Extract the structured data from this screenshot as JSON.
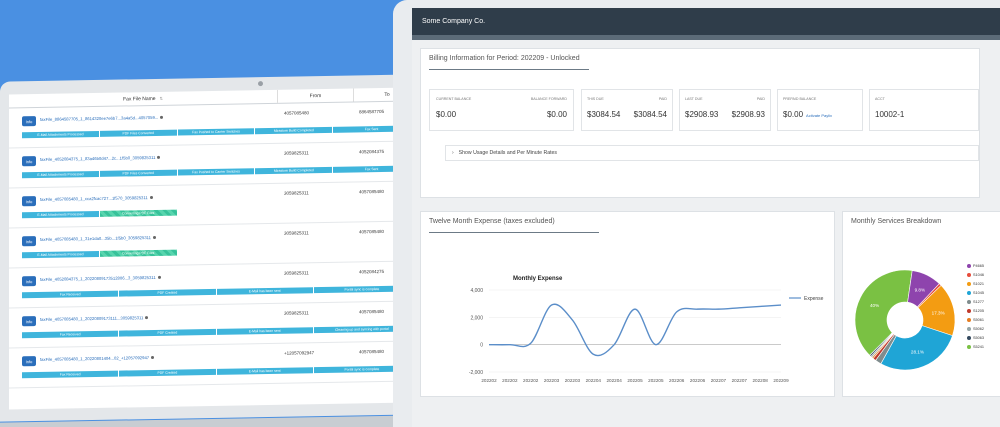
{
  "fax_list": {
    "columns": {
      "name": "Fax File Name",
      "from": "From",
      "to": "To"
    },
    "info_label": "Info",
    "rows": [
      {
        "file": "faxFile_8864587705_1_8614320ee7e6b7...3a4a5d...4057059...",
        "from": "4057085480",
        "to": "8864587705",
        "statuses": [
          "E-Mail Attachments Processed",
          "PDF Files Converted",
          "Fax Pushed to Carrier Switches",
          "Mirastore Build Completed",
          "Fax Sent"
        ]
      },
      {
        "file": "faxFile_4052084375_1_83a46b0d47...2c...1f5b0_3059825311",
        "from": "3059825311",
        "to": "4052084375",
        "statuses": [
          "E-Mail Attachments Processed",
          "PDF Files Converted",
          "Fax Pushed to Carrier Switches",
          "Mirastore Build Completed",
          "Fax Sent"
        ]
      },
      {
        "file": "faxFile_4057085480_1_cca2fcac727...1f570_3059825311",
        "from": "3059825311",
        "to": "4057085480",
        "statuses": [
          "E-Mail Attachments Processed",
          "Converting PDF Files"
        ]
      },
      {
        "file": "faxFile_4057085480_1_31e1da0...35b...1f5b0_3059825311",
        "from": "3059825311",
        "to": "4057085480",
        "statuses": [
          "E-Mail Attachments Processed",
          "Converting PDF Files"
        ]
      },
      {
        "file": "faxFile_4052084375_1_20220809173512806...3_3059825311",
        "from": "3059825311",
        "to": "4052084275",
        "statuses": [
          "Fax Received",
          "PDF Created",
          "E-Mail has been sent",
          "Portal sync is complete"
        ]
      },
      {
        "file": "faxFile_4057085480_1_20220809173111...3059825311",
        "from": "3059825311",
        "to": "4057085480",
        "statuses": [
          "Fax Received",
          "PDF Created",
          "E-Mail has been sent",
          "Cleaning up and syncing with portal"
        ]
      },
      {
        "file": "faxFile_4057085480_1_20220801404...02_+12057092947",
        "from": "+12057092947",
        "to": "4057085480",
        "statuses": [
          "Fax Received",
          "PDF Created",
          "E-Mail has been sent",
          "Portal sync is complete"
        ]
      }
    ]
  },
  "dashboard": {
    "company": "Some Company Co.",
    "billing_title": "Billing Information for Period: 202209 - Unlocked",
    "current_balance": {
      "label": "CURRENT BALANCE",
      "value": "$0.00"
    },
    "balance_forward": {
      "label": "BALANCE FORWARD",
      "value": "$0.00"
    },
    "this_due": {
      "label": "THIS DUE",
      "value": "$3084.54"
    },
    "this_paid": {
      "label": "PAID",
      "value": "$3084.54"
    },
    "last_due": {
      "label": "LAST DUE",
      "value": "$2908.93"
    },
    "last_paid": {
      "label": "PAID",
      "value": "$2908.93"
    },
    "prepaid": {
      "label": "PREPAID BALANCE",
      "value": "$0.00",
      "link": "Activate Paylix"
    },
    "acct": {
      "label": "ACCT",
      "value": "10002-1"
    },
    "usage_toggle": "Show Usage Details and Per Minute Rates",
    "expense_title": "Twelve Month Expense (taxes excluded)",
    "breakdown_title": "Monthly Services Breakdown"
  },
  "chart_data": [
    {
      "type": "line",
      "title": "Monthly Expense",
      "x": [
        "202202",
        "202202",
        "202202",
        "202203",
        "202203",
        "202204",
        "202204",
        "202205",
        "202205",
        "202206",
        "202206",
        "202207",
        "202207",
        "202208",
        "202209"
      ],
      "series": [
        {
          "name": "Expense",
          "values": [
            0,
            0,
            100,
            2900,
            1800,
            -700,
            0,
            2600,
            0,
            2400,
            2600,
            2600,
            2700,
            2800,
            2900
          ]
        }
      ],
      "y_ticks": [
        "4,000",
        "2,000",
        "0",
        "-2,000"
      ],
      "ylim": [
        -2000,
        4000
      ],
      "color": "#5b8ec9",
      "legend": "right"
    },
    {
      "type": "pie",
      "labels": [
        "P4665",
        "S1046",
        "S1021",
        "S1045",
        "S1277",
        "S1205",
        "S5061",
        "S5062",
        "S5063",
        "S5241"
      ],
      "values": [
        9.8,
        0.8,
        17.3,
        28.1,
        2.0,
        1.0,
        0.5,
        0.5,
        0.5,
        40
      ],
      "slice_labels": [
        "9.8%",
        "17.3%",
        "28.1%",
        "40%"
      ],
      "colors": [
        "#8e44ad",
        "#e74c3c",
        "#f39c12",
        "#1fa5d6",
        "#7f8c8d",
        "#c0392b",
        "#e67e22",
        "#95a5a6",
        "#34495e",
        "#7ac143"
      ],
      "donut": true
    }
  ]
}
